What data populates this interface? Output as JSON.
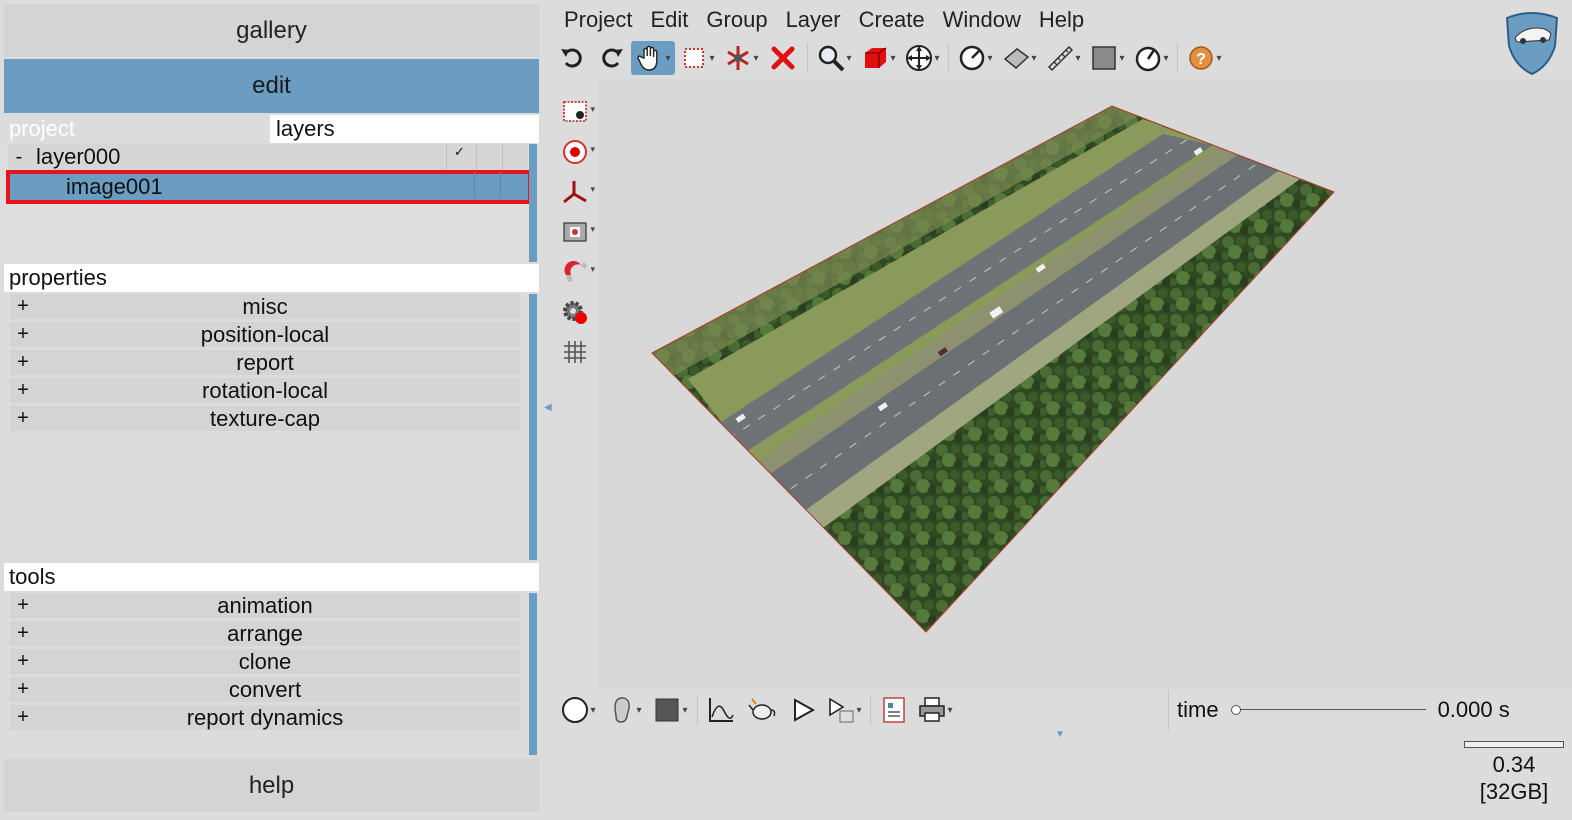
{
  "left_panel": {
    "gallery_label": "gallery",
    "edit_label": "edit",
    "help_label": "help",
    "tabs": {
      "project": "project",
      "layers": "layers"
    },
    "tree": {
      "layer": {
        "expander": "-",
        "name": "layer000",
        "checked": "✓"
      },
      "image": {
        "name": "image001"
      }
    },
    "properties": {
      "title": "properties",
      "items": [
        "misc",
        "position-local",
        "report",
        "rotation-local",
        "texture-cap"
      ]
    },
    "tools": {
      "title": "tools",
      "items": [
        "animation",
        "arrange",
        "clone",
        "convert",
        "report dynamics"
      ]
    },
    "plus_symbol": "+"
  },
  "menu": [
    "Project",
    "Edit",
    "Group",
    "Layer",
    "Create",
    "Window",
    "Help"
  ],
  "toolbar_icons": [
    "undo-icon",
    "redo-icon",
    "pan-hand-icon",
    "select-rect-icon",
    "snap-icon",
    "delete-icon",
    "zoom-icon",
    "cube-icon",
    "move-icon",
    "measure-angle-icon",
    "plane-icon",
    "ruler-icon",
    "square-icon",
    "gauge-icon",
    "help-icon"
  ],
  "vertical_tools": [
    "camera-target-icon",
    "record-icon",
    "axes-icon",
    "film-icon",
    "magnet-icon",
    "gear-record-icon",
    "grid-icon"
  ],
  "bottom_icons": [
    "circle-icon",
    "head-icon",
    "square-fill-icon",
    "graph-icon",
    "teapot-icon",
    "play-icon",
    "play-list-icon",
    "report-icon",
    "print-icon"
  ],
  "time": {
    "label": "time",
    "value": "0.000 s",
    "position": 0
  },
  "memory": {
    "value": "0.34",
    "total": "[32GB]"
  },
  "colors": {
    "accent": "#6b9dc3",
    "highlight_border": "#e8141c",
    "panel_bg": "#dcdcdc"
  }
}
